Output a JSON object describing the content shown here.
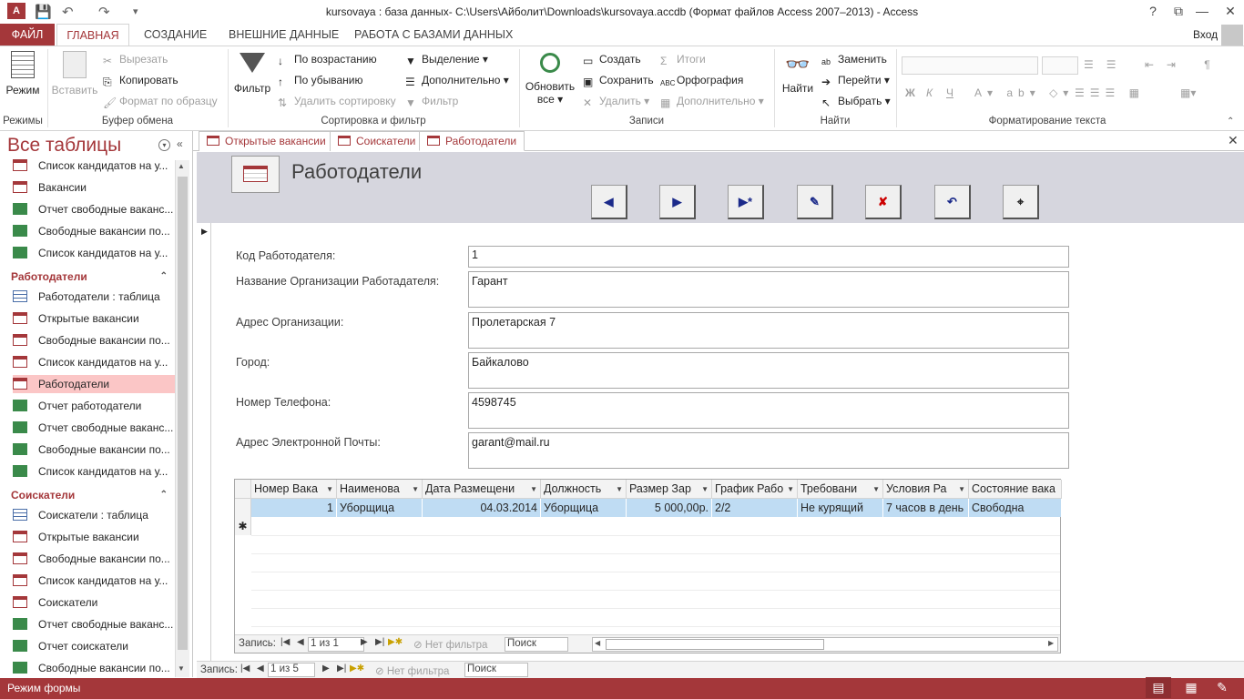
{
  "window": {
    "title": "kursovaya : база данных- C:\\Users\\Айболит\\Downloads\\kursovaya.accdb (Формат файлов Access 2007–2013) - Access",
    "help": "?",
    "login": "Вход"
  },
  "ribbon_tabs": [
    "ФАЙЛ",
    "ГЛАВНАЯ",
    "СОЗДАНИЕ",
    "ВНЕШНИЕ ДАННЫЕ",
    "РАБОТА С БАЗАМИ ДАННЫХ"
  ],
  "ribbon": {
    "views": {
      "mode": "Режим",
      "group": "Режимы"
    },
    "clipboard": {
      "paste": "Вставить",
      "cut": "Вырезать",
      "copy": "Копировать",
      "format_painter": "Формат по образцу",
      "group": "Буфер обмена"
    },
    "sort": {
      "filter": "Фильтр",
      "asc": "По возрастанию",
      "desc": "По убыванию",
      "remove": "Удалить сортировку",
      "selection": "Выделение",
      "advanced": "Дополнительно",
      "toggle": "Фильтр",
      "group": "Сортировка и фильтр"
    },
    "records": {
      "refresh": "Обновить",
      "refresh2": "все",
      "new": "Создать",
      "save": "Сохранить",
      "delete": "Удалить",
      "totals": "Итоги",
      "spelling": "Орфография",
      "more": "Дополнительно",
      "group": "Записи"
    },
    "find": {
      "find": "Найти",
      "replace": "Заменить",
      "goto": "Перейти",
      "select": "Выбрать",
      "group": "Найти"
    },
    "text": {
      "bold": "Ж",
      "italic": "К",
      "underline": "Ч",
      "group": "Форматирование текста"
    }
  },
  "nav": {
    "title": "Все таблицы",
    "items_top": [
      {
        "label": "Список кандидатов на у...",
        "kind": "frm"
      },
      {
        "label": "Вакансии",
        "kind": "frm"
      },
      {
        "label": "Отчет свободные ваканс...",
        "kind": "rpt"
      },
      {
        "label": "Свободные вакансии по...",
        "kind": "rpt"
      },
      {
        "label": "Список кандидатов на у...",
        "kind": "rpt"
      }
    ],
    "group1": "Работодатели",
    "items_g1": [
      {
        "label": "Работодатели : таблица",
        "kind": "tbl"
      },
      {
        "label": "Открытые вакансии",
        "kind": "frm"
      },
      {
        "label": "Свободные вакансии по...",
        "kind": "frm"
      },
      {
        "label": "Список кандидатов на у...",
        "kind": "frm"
      },
      {
        "label": "Работодатели",
        "kind": "frm"
      },
      {
        "label": "Отчет работодатели",
        "kind": "rpt"
      },
      {
        "label": "Отчет свободные ваканс...",
        "kind": "rpt"
      },
      {
        "label": "Свободные вакансии по...",
        "kind": "rpt"
      },
      {
        "label": "Список кандидатов на у...",
        "kind": "rpt"
      }
    ],
    "group2": "Соискатели",
    "items_g2": [
      {
        "label": "Соискатели : таблица",
        "kind": "tbl"
      },
      {
        "label": "Открытые вакансии",
        "kind": "frm"
      },
      {
        "label": "Свободные вакансии по...",
        "kind": "frm"
      },
      {
        "label": "Список кандидатов на у...",
        "kind": "frm"
      },
      {
        "label": "Соискатели",
        "kind": "frm"
      },
      {
        "label": "Отчет свободные ваканс...",
        "kind": "rpt"
      },
      {
        "label": "Отчет соискатели",
        "kind": "rpt"
      },
      {
        "label": "Свободные вакансии по...",
        "kind": "rpt"
      }
    ]
  },
  "doc_tabs": [
    "Открытые вакансии",
    "Соискатели",
    "Работодатели"
  ],
  "form": {
    "title": "Работодатели",
    "fields": [
      {
        "label": "Код Работодателя:",
        "value": "1"
      },
      {
        "label": "Название Организации Работадателя:",
        "value": "Гарант"
      },
      {
        "label": "Адрес Организации:",
        "value": "Пролетарская 7"
      },
      {
        "label": "Город:",
        "value": "Байкалово"
      },
      {
        "label": "Номер Телефона:",
        "value": "4598745"
      },
      {
        "label": "Адрес Электронной Почты:",
        "value": "garant@mail.ru"
      }
    ]
  },
  "subform": {
    "columns": [
      "Номер Вака",
      "Наименова",
      "Дата Размещени",
      "Должность",
      "Размер Зар",
      "График Рабо",
      "Требовани",
      "Условия Ра",
      "Состояние вака"
    ],
    "rows": [
      [
        "1",
        "Уборщица",
        "04.03.2014",
        "Уборщица",
        "5 000,00р.",
        "2/2",
        "Не курящий",
        "7 часов в день",
        "Свободна"
      ]
    ],
    "nav": {
      "label": "Запись:",
      "pos": "1 из 1",
      "filter": "Нет фильтра",
      "search": "Поиск"
    }
  },
  "main_nav": {
    "label": "Запись:",
    "pos": "1 из 5",
    "filter": "Нет фильтра",
    "search": "Поиск"
  },
  "status": {
    "text": "Режим формы"
  }
}
